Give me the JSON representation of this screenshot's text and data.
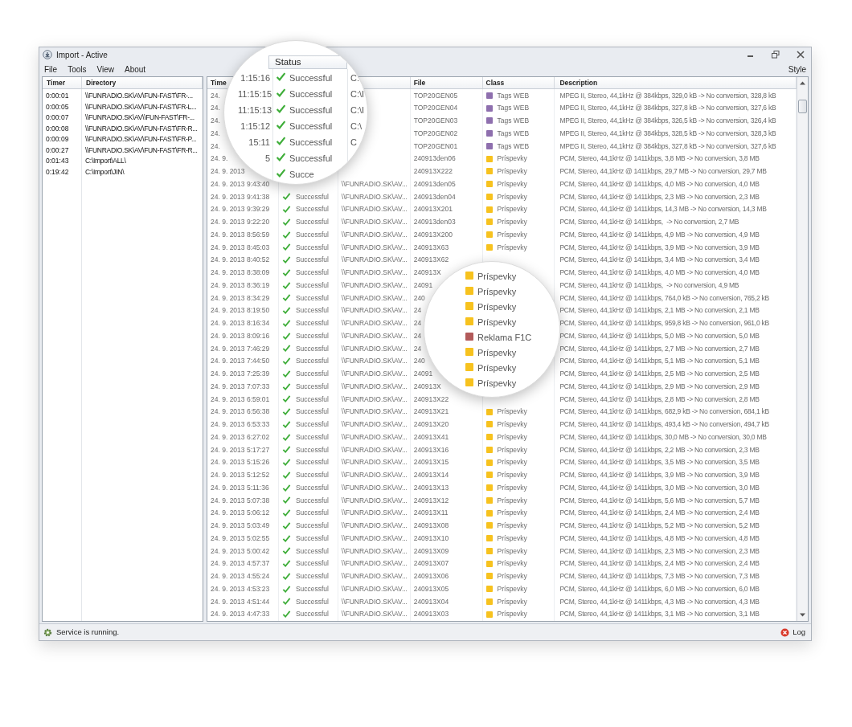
{
  "window": {
    "title": "Import - Active"
  },
  "menu": [
    {
      "label": "File"
    },
    {
      "label": "Tools"
    },
    {
      "label": "View"
    },
    {
      "label": "About"
    }
  ],
  "menu_right": "Style",
  "timers": {
    "columns": [
      "Timer",
      "Directory"
    ],
    "rows": [
      {
        "timer": "0:00:01",
        "directory": "\\\\FUNRADIO.SK\\AV\\FUN-FAST\\FR-..."
      },
      {
        "timer": "0:00:05",
        "directory": "\\\\FUNRADIO.SK\\AV\\FUN-FAST\\FR-L..."
      },
      {
        "timer": "0:00:07",
        "directory": "\\\\FUNRADIO.SK\\AV\\\\FUN-FAST\\FR-..."
      },
      {
        "timer": "0:00:08",
        "directory": "\\\\FUNRADIO.SK\\AV\\FUN-FAST\\FR-R..."
      },
      {
        "timer": "0:00:09",
        "directory": "\\\\FUNRADIO.SK\\AV\\FUN-FAST\\FR-P..."
      },
      {
        "timer": "0:00:27",
        "directory": "\\\\FUNRADIO.SK\\AV\\FUN-FAST\\FR-R..."
      },
      {
        "timer": "0:01:43",
        "directory": "C:\\Import\\ALL\\"
      },
      {
        "timer": "0:19:42",
        "directory": "C:\\Import\\JIN\\"
      }
    ]
  },
  "log": {
    "header": {
      "time": "Time",
      "file": "File",
      "class": "Class",
      "description": "Description"
    },
    "rows": [
      {
        "time": "24.",
        "file": "TOP20GEN05",
        "class": {
          "label": "Tags WEB",
          "color": "#8e6fae"
        },
        "description": "MPEG II, Stereo, 44,1kHz @ 384kbps, 329,0 kB -> No conversion, 328,8 kB"
      },
      {
        "time": "24.",
        "file": "TOP20GEN04",
        "class": {
          "label": "Tags WEB",
          "color": "#8e6fae"
        },
        "description": "MPEG II, Stereo, 44,1kHz @ 384kbps, 327,8 kB -> No conversion, 327,6 kB"
      },
      {
        "time": "24.",
        "file": "TOP20GEN03",
        "class": {
          "label": "Tags WEB",
          "color": "#8e6fae"
        },
        "description": "MPEG II, Stereo, 44,1kHz @ 384kbps, 326,5 kB -> No conversion, 326,4 kB"
      },
      {
        "time": "24.",
        "file": "TOP20GEN02",
        "class": {
          "label": "Tags WEB",
          "color": "#8e6fae"
        },
        "description": "MPEG II, Stereo, 44,1kHz @ 384kbps, 328,5 kB -> No conversion, 328,3 kB"
      },
      {
        "time": "24.",
        "file": "TOP20GEN01",
        "class": {
          "label": "Tags WEB",
          "color": "#8e6fae"
        },
        "description": "MPEG II, Stereo, 44,1kHz @ 384kbps, 327,8 kB -> No conversion, 327,6 kB"
      },
      {
        "time": "24. 9.",
        "file": "240913den06",
        "class": {
          "label": "Príspevky",
          "color": "#f7c21e"
        },
        "description": "PCM, Stereo, 44,1kHz @ 1411kbps, 3,8 MB -> No conversion, 3,8 MB"
      },
      {
        "time": "24. 9. 2013",
        "file": "240913X222",
        "class": {
          "label": "Príspevky",
          "color": "#f7c21e"
        },
        "description": "PCM, Stereo, 44,1kHz @ 1411kbps, 29,7 MB -> No conversion, 29,7 MB"
      },
      {
        "time": "24. 9. 2013 9:43:40",
        "directory": "\\\\FUNRADIO.SK\\AV...",
        "file": "240913den05",
        "class": {
          "label": "Príspevky",
          "color": "#f7c21e"
        },
        "description": "PCM, Stereo, 44,1kHz @ 1411kbps, 4,0 MB -> No conversion, 4,0 MB"
      },
      {
        "time": "24. 9. 2013 9:41:38",
        "status": "Successful",
        "success": true,
        "directory": "\\\\FUNRADIO.SK\\AV...",
        "file": "240913den04",
        "class": {
          "label": "Príspevky",
          "color": "#f7c21e"
        },
        "description": "PCM, Stereo, 44,1kHz @ 1411kbps, 2,3 MB -> No conversion, 2,3 MB"
      },
      {
        "time": "24. 9. 2013 9:39:29",
        "status": "Successful",
        "success": true,
        "directory": "\\\\FUNRADIO.SK\\AV...",
        "file": "240913X201",
        "class": {
          "label": "Príspevky",
          "color": "#f7c21e"
        },
        "description": "PCM, Stereo, 44,1kHz @ 1411kbps, 14,3 MB -> No conversion, 14,3 MB"
      },
      {
        "time": "24. 9. 2013 9:22:20",
        "status": "Successful",
        "success": true,
        "directory": "\\\\FUNRADIO.SK\\AV...",
        "file": "240913den03",
        "class": {
          "label": "Príspevky",
          "color": "#f7c21e"
        },
        "description": "PCM, Stereo, 44,1kHz @ 1411kbps,  -> No conversion, 2,7 MB"
      },
      {
        "time": "24. 9. 2013 8:56:59",
        "status": "Successful",
        "success": true,
        "directory": "\\\\FUNRADIO.SK\\AV...",
        "file": "240913X200",
        "class": {
          "label": "Príspevky",
          "color": "#f7c21e"
        },
        "description": "PCM, Stereo, 44,1kHz @ 1411kbps, 4,9 MB -> No conversion, 4,9 MB"
      },
      {
        "time": "24. 9. 2013 8:45:03",
        "status": "Successful",
        "success": true,
        "directory": "\\\\FUNRADIO.SK\\AV...",
        "file": "240913X63",
        "class": {
          "label": "Príspevky",
          "color": "#f7c21e"
        },
        "description": "PCM, Stereo, 44,1kHz @ 1411kbps, 3,9 MB -> No conversion, 3,9 MB"
      },
      {
        "time": "24. 9. 2013 8:40:52",
        "status": "Successful",
        "success": true,
        "directory": "\\\\FUNRADIO.SK\\AV...",
        "file": "240913X62",
        "description": "PCM, Stereo, 44,1kHz @ 1411kbps, 3,4 MB -> No conversion, 3,4 MB"
      },
      {
        "time": "24. 9. 2013 8:38:09",
        "status": "Successful",
        "success": true,
        "directory": "\\\\FUNRADIO.SK\\AV...",
        "file": "240913X",
        "description": "PCM, Stereo, 44,1kHz @ 1411kbps, 4,0 MB -> No conversion, 4,0 MB"
      },
      {
        "time": "24. 9. 2013 8:36:19",
        "status": "Successful",
        "success": true,
        "directory": "\\\\FUNRADIO.SK\\AV...",
        "file": "24091",
        "description": "PCM, Stereo, 44,1kHz @ 1411kbps,  -> No conversion, 4,9 MB"
      },
      {
        "time": "24. 9. 2013 8:34:29",
        "status": "Successful",
        "success": true,
        "directory": "\\\\FUNRADIO.SK\\AV...",
        "file": "240",
        "description": "PCM, Stereo, 44,1kHz @ 1411kbps, 764,0 kB -> No conversion, 765,2 kB"
      },
      {
        "time": "24. 9. 2013 8:19:50",
        "status": "Successful",
        "success": true,
        "directory": "\\\\FUNRADIO.SK\\AV...",
        "file": "24",
        "description": "PCM, Stereo, 44,1kHz @ 1411kbps, 2,1 MB -> No conversion, 2,1 MB"
      },
      {
        "time": "24. 9. 2013 8:16:34",
        "status": "Successful",
        "success": true,
        "directory": "\\\\FUNRADIO.SK\\AV...",
        "file": "24",
        "description": "PCM, Stereo, 44,1kHz @ 1411kbps, 959,8 kB -> No conversion, 961,0 kB"
      },
      {
        "time": "24. 9. 2013 8:09:16",
        "status": "Successful",
        "success": true,
        "directory": "\\\\FUNRADIO.SK\\AV...",
        "file": "24",
        "description": "PCM, Stereo, 44,1kHz @ 1411kbps, 5,0 MB -> No conversion, 5,0 MB"
      },
      {
        "time": "24. 9. 2013 7:46:29",
        "status": "Successful",
        "success": true,
        "directory": "\\\\FUNRADIO.SK\\AV...",
        "file": "24",
        "description": "PCM, Stereo, 44,1kHz @ 1411kbps, 2,7 MB -> No conversion, 2,7 MB"
      },
      {
        "time": "24. 9. 2013 7:44:50",
        "status": "Successful",
        "success": true,
        "directory": "\\\\FUNRADIO.SK\\AV...",
        "file": "240",
        "description": "PCM, Stereo, 44,1kHz @ 1411kbps, 5,1 MB -> No conversion, 5,1 MB"
      },
      {
        "time": "24. 9. 2013 7:25:39",
        "status": "Successful",
        "success": true,
        "directory": "\\\\FUNRADIO.SK\\AV...",
        "file": "24091",
        "description": "PCM, Stereo, 44,1kHz @ 1411kbps, 2,5 MB -> No conversion, 2,5 MB"
      },
      {
        "time": "24. 9. 2013 7:07:33",
        "status": "Successful",
        "success": true,
        "directory": "\\\\FUNRADIO.SK\\AV...",
        "file": "240913X",
        "description": "PCM, Stereo, 44,1kHz @ 1411kbps, 2,9 MB -> No conversion, 2,9 MB"
      },
      {
        "time": "24. 9. 2013 6:59:01",
        "status": "Successful",
        "success": true,
        "directory": "\\\\FUNRADIO.SK\\AV...",
        "file": "240913X22",
        "description": "PCM, Stereo, 44,1kHz @ 1411kbps, 2,8 MB -> No conversion, 2,8 MB"
      },
      {
        "time": "24. 9. 2013 6:56:38",
        "status": "Successful",
        "success": true,
        "directory": "\\\\FUNRADIO.SK\\AV...",
        "file": "240913X21",
        "class": {
          "label": "Príspevky",
          "color": "#f7c21e"
        },
        "description": "PCM, Stereo, 44,1kHz @ 1411kbps, 682,9 kB -> No conversion, 684,1 kB"
      },
      {
        "time": "24. 9. 2013 6:53:33",
        "status": "Successful",
        "success": true,
        "directory": "\\\\FUNRADIO.SK\\AV...",
        "file": "240913X20",
        "class": {
          "label": "Príspevky",
          "color": "#f7c21e"
        },
        "description": "PCM, Stereo, 44,1kHz @ 1411kbps, 493,4 kB -> No conversion, 494,7 kB"
      },
      {
        "time": "24. 9. 2013 6:27:02",
        "status": "Successful",
        "success": true,
        "directory": "\\\\FUNRADIO.SK\\AV...",
        "file": "240913X41",
        "class": {
          "label": "Príspevky",
          "color": "#f7c21e"
        },
        "description": "PCM, Stereo, 44,1kHz @ 1411kbps, 30,0 MB -> No conversion, 30,0 MB"
      },
      {
        "time": "24. 9. 2013 5:17:27",
        "status": "Successful",
        "success": true,
        "directory": "\\\\FUNRADIO.SK\\AV...",
        "file": "240913X16",
        "class": {
          "label": "Príspevky",
          "color": "#f7c21e"
        },
        "description": "PCM, Stereo, 44,1kHz @ 1411kbps, 2,2 MB -> No conversion, 2,3 MB"
      },
      {
        "time": "24. 9. 2013 5:15:26",
        "status": "Successful",
        "success": true,
        "directory": "\\\\FUNRADIO.SK\\AV...",
        "file": "240913X15",
        "class": {
          "label": "Príspevky",
          "color": "#f7c21e"
        },
        "description": "PCM, Stereo, 44,1kHz @ 1411kbps, 3,5 MB -> No conversion, 3,5 MB"
      },
      {
        "time": "24. 9. 2013 5:12:52",
        "status": "Successful",
        "success": true,
        "directory": "\\\\FUNRADIO.SK\\AV...",
        "file": "240913X14",
        "class": {
          "label": "Príspevky",
          "color": "#f7c21e"
        },
        "description": "PCM, Stereo, 44,1kHz @ 1411kbps, 3,9 MB -> No conversion, 3,9 MB"
      },
      {
        "time": "24. 9. 2013 5:11:36",
        "status": "Successful",
        "success": true,
        "directory": "\\\\FUNRADIO.SK\\AV...",
        "file": "240913X13",
        "class": {
          "label": "Príspevky",
          "color": "#f7c21e"
        },
        "description": "PCM, Stereo, 44,1kHz @ 1411kbps, 3,0 MB -> No conversion, 3,0 MB"
      },
      {
        "time": "24. 9. 2013 5:07:38",
        "status": "Successful",
        "success": true,
        "directory": "\\\\FUNRADIO.SK\\AV...",
        "file": "240913X12",
        "class": {
          "label": "Príspevky",
          "color": "#f7c21e"
        },
        "description": "PCM, Stereo, 44,1kHz @ 1411kbps, 5,6 MB -> No conversion, 5,7 MB"
      },
      {
        "time": "24. 9. 2013 5:06:12",
        "status": "Successful",
        "success": true,
        "directory": "\\\\FUNRADIO.SK\\AV...",
        "file": "240913X11",
        "class": {
          "label": "Príspevky",
          "color": "#f7c21e"
        },
        "description": "PCM, Stereo, 44,1kHz @ 1411kbps, 2,4 MB -> No conversion, 2,4 MB"
      },
      {
        "time": "24. 9. 2013 5:03:49",
        "status": "Successful",
        "success": true,
        "directory": "\\\\FUNRADIO.SK\\AV...",
        "file": "240913X08",
        "class": {
          "label": "Príspevky",
          "color": "#f7c21e"
        },
        "description": "PCM, Stereo, 44,1kHz @ 1411kbps, 5,2 MB -> No conversion, 5,2 MB"
      },
      {
        "time": "24. 9. 2013 5:02:55",
        "status": "Successful",
        "success": true,
        "directory": "\\\\FUNRADIO.SK\\AV...",
        "file": "240913X10",
        "class": {
          "label": "Príspevky",
          "color": "#f7c21e"
        },
        "description": "PCM, Stereo, 44,1kHz @ 1411kbps, 4,8 MB -> No conversion, 4,8 MB"
      },
      {
        "time": "24. 9. 2013 5:00:42",
        "status": "Successful",
        "success": true,
        "directory": "\\\\FUNRADIO.SK\\AV...",
        "file": "240913X09",
        "class": {
          "label": "Príspevky",
          "color": "#f7c21e"
        },
        "description": "PCM, Stereo, 44,1kHz @ 1411kbps, 2,3 MB -> No conversion, 2,3 MB"
      },
      {
        "time": "24. 9. 2013 4:57:37",
        "status": "Successful",
        "success": true,
        "directory": "\\\\FUNRADIO.SK\\AV...",
        "file": "240913X07",
        "class": {
          "label": "Príspevky",
          "color": "#f7c21e"
        },
        "description": "PCM, Stereo, 44,1kHz @ 1411kbps, 2,4 MB -> No conversion, 2,4 MB"
      },
      {
        "time": "24. 9. 2013 4:55:24",
        "status": "Successful",
        "success": true,
        "directory": "\\\\FUNRADIO.SK\\AV...",
        "file": "240913X06",
        "class": {
          "label": "Príspevky",
          "color": "#f7c21e"
        },
        "description": "PCM, Stereo, 44,1kHz @ 1411kbps, 7,3 MB -> No conversion, 7,3 MB"
      },
      {
        "time": "24. 9. 2013 4:53:23",
        "status": "Successful",
        "success": true,
        "directory": "\\\\FUNRADIO.SK\\AV...",
        "file": "240913X05",
        "class": {
          "label": "Príspevky",
          "color": "#f7c21e"
        },
        "description": "PCM, Stereo, 44,1kHz @ 1411kbps, 6,0 MB -> No conversion, 6,0 MB"
      },
      {
        "time": "24. 9. 2013 4:51:44",
        "status": "Successful",
        "success": true,
        "directory": "\\\\FUNRADIO.SK\\AV...",
        "file": "240913X04",
        "class": {
          "label": "Príspevky",
          "color": "#f7c21e"
        },
        "description": "PCM, Stereo, 44,1kHz @ 1411kbps, 4,3 MB -> No conversion, 4,3 MB"
      },
      {
        "time": "24. 9. 2013 4:47:33",
        "status": "Successful",
        "success": true,
        "directory": "\\\\FUNRADIO.SK\\AV...",
        "file": "240913X03",
        "class": {
          "label": "Príspevky",
          "color": "#f7c21e"
        },
        "description": "PCM, Stereo, 44,1kHz @ 1411kbps, 3,1 MB -> No conversion, 3,1 MB"
      }
    ]
  },
  "magnifier_status": {
    "header": "Status",
    "rows": [
      {
        "time": "1:15:16",
        "status": "Successful",
        "success": true,
        "directory": "C:"
      },
      {
        "time": "11:15:15",
        "status": "Successful",
        "success": true,
        "directory": "C:\\I"
      },
      {
        "time": "11:15:13",
        "status": "Successful",
        "success": true,
        "directory": "C:\\I"
      },
      {
        "time": "1:15:12",
        "status": "Successful",
        "success": true,
        "directory": "C:\\"
      },
      {
        "time": "15:11",
        "status": "Successful",
        "success": true,
        "directory": "C"
      },
      {
        "time": "5",
        "status": "Successful",
        "success": true
      },
      {
        "status": "Succe",
        "success": true
      }
    ]
  },
  "magnifier_class": {
    "rows": [
      {
        "label": "Príspevky",
        "color": "#f7c21e"
      },
      {
        "label": "Príspevky",
        "color": "#f7c21e"
      },
      {
        "label": "Príspevky",
        "color": "#f7c21e"
      },
      {
        "label": "Príspevky",
        "color": "#f7c21e"
      },
      {
        "label": "Reklama F1C",
        "color": "#b25a5a"
      },
      {
        "label": "Príspevky",
        "color": "#f7c21e"
      },
      {
        "label": "Príspevky",
        "color": "#f7c21e"
      },
      {
        "label": "Príspevky",
        "color": "#f7c21e"
      }
    ]
  },
  "status_bar": {
    "message": "Service is running.",
    "log_button": "Log"
  }
}
